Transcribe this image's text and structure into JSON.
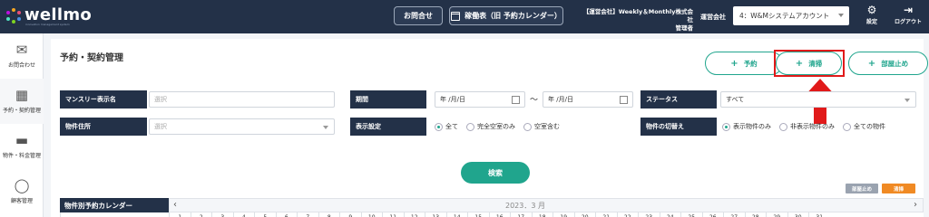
{
  "header": {
    "logo_text": "wellmo",
    "logo_sub": "innovation management system",
    "contact_button": "お問合せ",
    "calendar_button": "稼働表（旧 予約カレンダー）",
    "company_line1": "【運営会社】Weekly＆Monthly株式会社",
    "company_line2": "管理者",
    "operator_label": "運営会社",
    "operator_value": "4：W&Mシステムアカウント",
    "settings_label": "設定",
    "logout_label": "ログアウト"
  },
  "sidebar": {
    "items": [
      {
        "label": "お問合わせ",
        "icon": "mail-icon"
      },
      {
        "label": "予約・契約管理",
        "icon": "calendar-icon"
      },
      {
        "label": "物件・料金管理",
        "icon": "bed-icon"
      },
      {
        "label": "顧客管理",
        "icon": "user-icon"
      }
    ]
  },
  "page": {
    "title": "予約・契約管理",
    "actions": {
      "reserve": "予約",
      "clean": "清掃",
      "stop": "部屋止め"
    }
  },
  "filters": {
    "monthly_name_label": "マンスリー表示名",
    "monthly_name_placeholder": "選択",
    "period_label": "期間",
    "period_from": "年 /月/日",
    "period_tilde": "〜",
    "period_to": "年 /月/日",
    "status_label": "ステータス",
    "status_value": "すべて",
    "address_label": "物件住所",
    "address_placeholder": "選択",
    "display_label": "表示設定",
    "display_options": [
      "全て",
      "完全空室のみ",
      "空室含む"
    ],
    "switch_label": "物件の切替え",
    "switch_options": [
      "表示物件のみ",
      "非表示物件のみ",
      "全ての物件"
    ]
  },
  "search_button": "検索",
  "legend": {
    "stop": "部屋止め",
    "clean": "清掃"
  },
  "calendar": {
    "title": "物件別予約カレンダー",
    "month": "2023．3 月",
    "days": [
      "1",
      "2",
      "3",
      "4",
      "5",
      "6",
      "7",
      "8",
      "9",
      "10",
      "11",
      "12",
      "13",
      "14",
      "15",
      "16",
      "17",
      "18",
      "19",
      "20",
      "21",
      "22",
      "23",
      "24",
      "25",
      "26",
      "27",
      "28",
      "29",
      "30",
      "31"
    ]
  },
  "colors": {
    "navy": "#233148",
    "teal": "#20a58d",
    "highlight": "#e11a1a",
    "orange": "#f08a24"
  }
}
